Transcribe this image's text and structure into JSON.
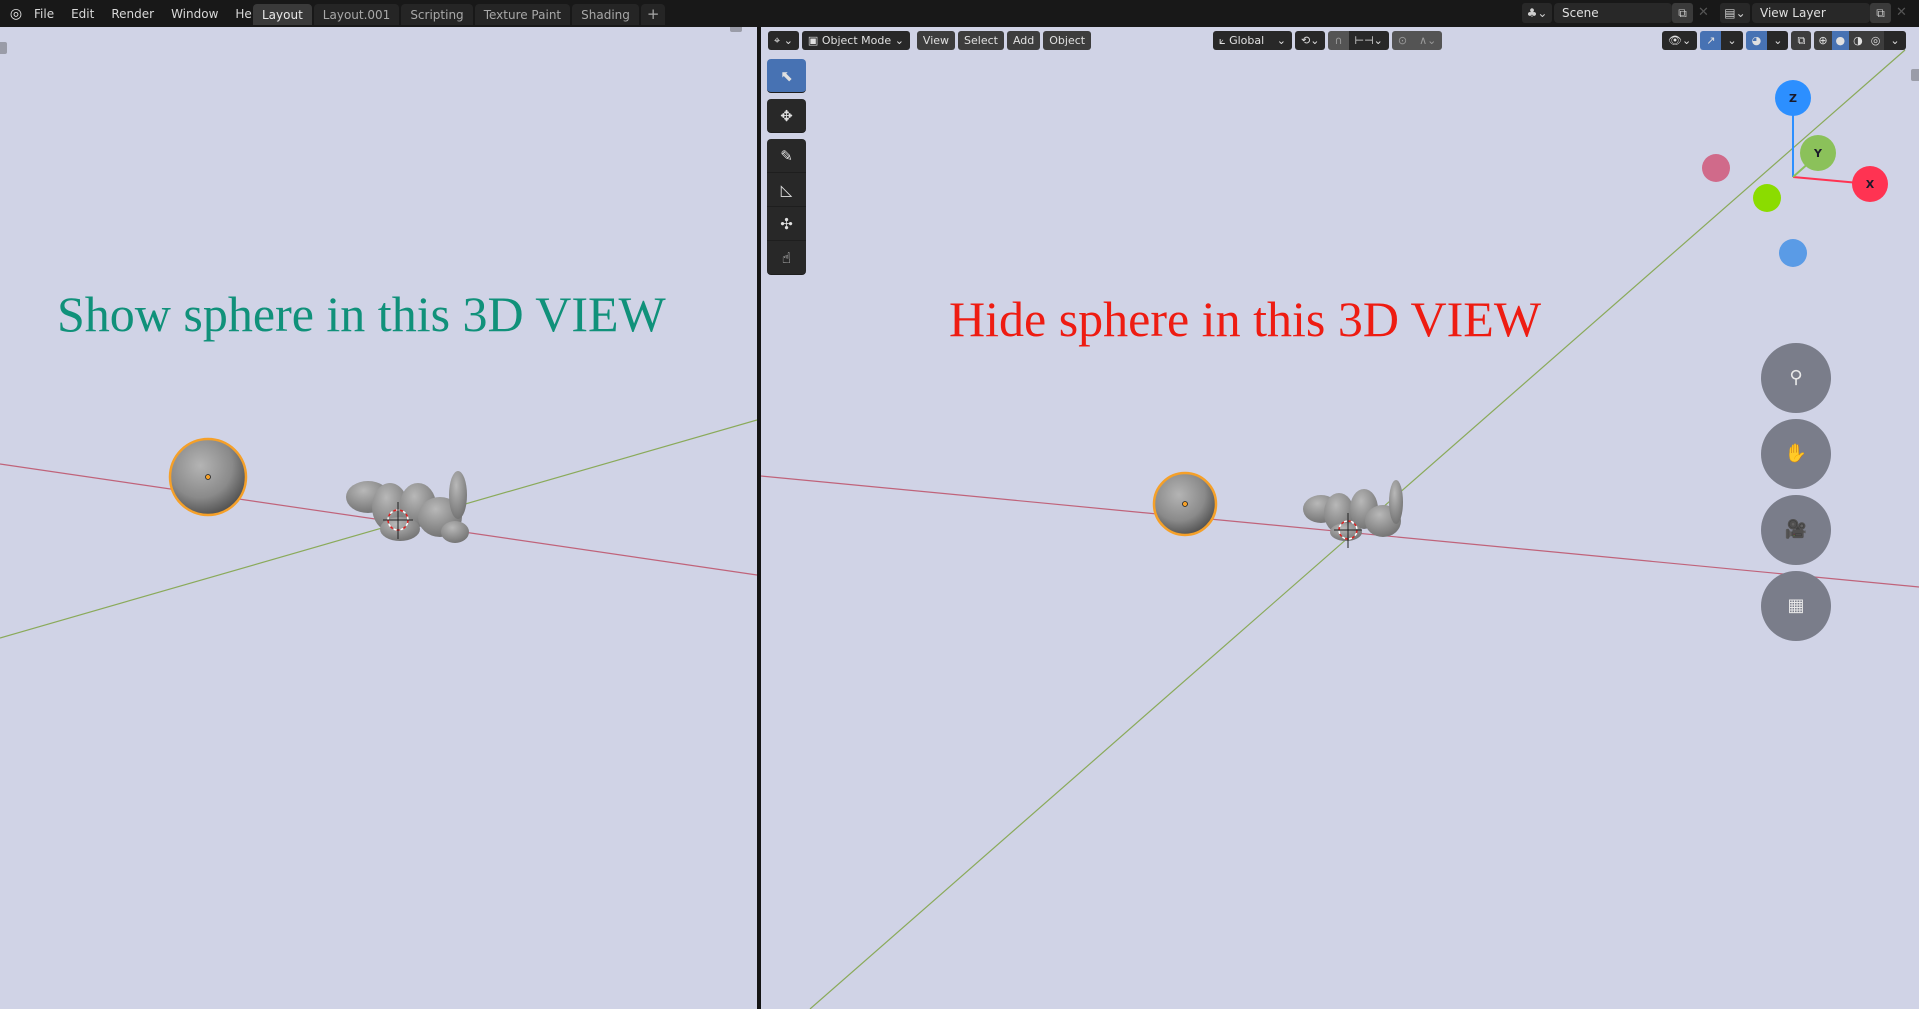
{
  "topbar": {
    "logo_icon": "blender-logo-icon",
    "menus": [
      "File",
      "Edit",
      "Render",
      "Window",
      "Help"
    ],
    "workspace_tabs": [
      {
        "label": "Layout",
        "active": true
      },
      {
        "label": "Layout.001",
        "active": false
      },
      {
        "label": "Scripting",
        "active": false
      },
      {
        "label": "Texture Paint",
        "active": false
      },
      {
        "label": "Shading",
        "active": false
      }
    ],
    "add_tab_label": "+",
    "scene": {
      "icon": "scene-icon",
      "value": "Scene"
    },
    "view_layer": {
      "icon": "view-layer-icon",
      "value": "View Layer"
    },
    "copy_glyph": "⧉",
    "close_glyph": "✕"
  },
  "left_view": {
    "annotation": "Show sphere in this 3D VIEW",
    "annotation_color": "#10917a"
  },
  "right_view": {
    "annotation": "Hide sphere in this 3D VIEW",
    "annotation_color": "#ee1c12",
    "header": {
      "editor_type_glyph": "⌖",
      "mode": "Object Mode",
      "menus": [
        "View",
        "Select",
        "Add",
        "Object"
      ],
      "orientation": "Global",
      "pivot_glyph": "⟲",
      "snap_glyph": "∩",
      "snap_increment_glyph": "⊢⊣",
      "proportional_glyph": "⊙",
      "falloff_glyph": "∧",
      "chevron": "⌄"
    },
    "tools": [
      {
        "name": "select-box",
        "glyph": "⬉"
      },
      {
        "name": "move",
        "glyph": "✥"
      },
      {
        "name": "annotate",
        "glyph": "✎"
      },
      {
        "name": "measure",
        "glyph": "◺"
      },
      {
        "name": "add-cube",
        "glyph": "✣"
      },
      {
        "name": "cursor",
        "glyph": "☝"
      }
    ],
    "gizmo": {
      "axes": [
        {
          "label": "Z",
          "color": "#2c8fff"
        },
        {
          "label": "Y",
          "color": "#8bc15a"
        },
        {
          "label": "X",
          "color": "#ff3352"
        }
      ],
      "negative_colors": {
        "x": "#d06a8a",
        "y": "#8bdc00",
        "z": "#5a9be6"
      }
    },
    "nav_buttons": [
      {
        "name": "zoom",
        "glyph": "⚲"
      },
      {
        "name": "pan",
        "glyph": "✋"
      },
      {
        "name": "camera",
        "glyph": "🎥"
      },
      {
        "name": "perspective",
        "glyph": "▦"
      }
    ],
    "shading_modes": [
      "wireframe",
      "solid",
      "material",
      "rendered"
    ],
    "active_shading": "solid"
  },
  "colors": {
    "viewport_bg": "#d0d3e6",
    "x_axis": "#c0637a",
    "y_axis": "#8aaa5a",
    "selection_outline": "#f5a029",
    "mesh": "#8f8f8f"
  }
}
